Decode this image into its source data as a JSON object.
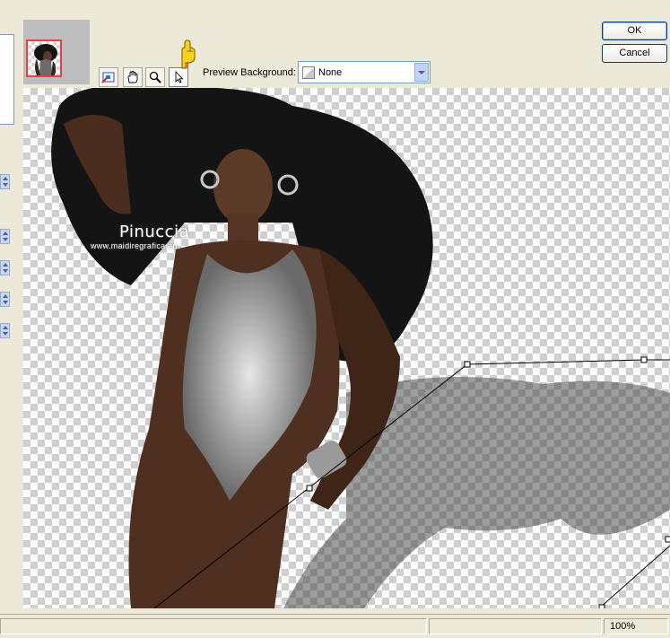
{
  "toolbar": {
    "tools": [
      "pan-tool",
      "hand-tool",
      "zoom-tool",
      "pointer-tool"
    ],
    "active_tool": "pointer-tool"
  },
  "preview_background": {
    "label": "Preview Background:",
    "value": "None"
  },
  "buttons": {
    "ok": "OK",
    "cancel": "Cancel"
  },
  "watermark": {
    "title": "Pinuccia",
    "url": "www.maidiregrafica.eu"
  },
  "status": {
    "zoom": "100%"
  }
}
